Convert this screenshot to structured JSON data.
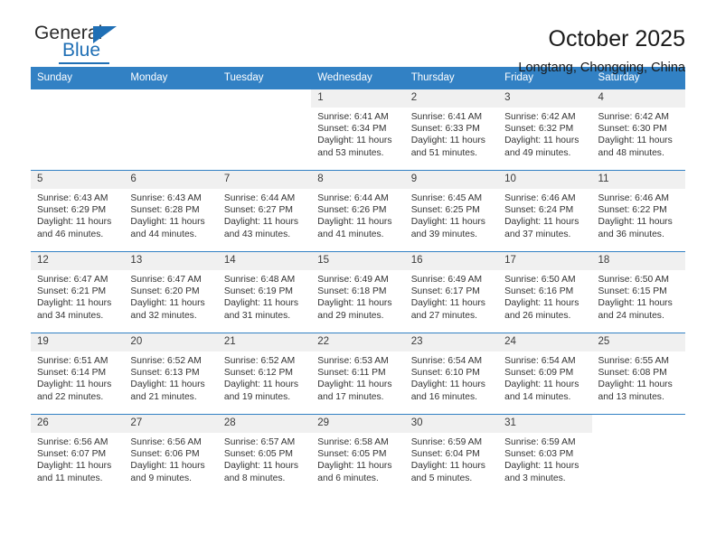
{
  "brand": {
    "name_part1": "General",
    "name_part2": "Blue",
    "accent_color": "#1f6fb5"
  },
  "header": {
    "title": "October 2025",
    "subtitle": "Longtang, Chongqing, China"
  },
  "calendar": {
    "header_bg": "#3281c4",
    "datenum_bg": "#f0f0f0",
    "weekdays": [
      "Sunday",
      "Monday",
      "Tuesday",
      "Wednesday",
      "Thursday",
      "Friday",
      "Saturday"
    ],
    "weeks": [
      [
        {
          "day": "",
          "sunrise": "",
          "sunset": "",
          "daylight1": "",
          "daylight2": ""
        },
        {
          "day": "",
          "sunrise": "",
          "sunset": "",
          "daylight1": "",
          "daylight2": ""
        },
        {
          "day": "",
          "sunrise": "",
          "sunset": "",
          "daylight1": "",
          "daylight2": ""
        },
        {
          "day": "1",
          "sunrise": "Sunrise: 6:41 AM",
          "sunset": "Sunset: 6:34 PM",
          "daylight1": "Daylight: 11 hours",
          "daylight2": "and 53 minutes."
        },
        {
          "day": "2",
          "sunrise": "Sunrise: 6:41 AM",
          "sunset": "Sunset: 6:33 PM",
          "daylight1": "Daylight: 11 hours",
          "daylight2": "and 51 minutes."
        },
        {
          "day": "3",
          "sunrise": "Sunrise: 6:42 AM",
          "sunset": "Sunset: 6:32 PM",
          "daylight1": "Daylight: 11 hours",
          "daylight2": "and 49 minutes."
        },
        {
          "day": "4",
          "sunrise": "Sunrise: 6:42 AM",
          "sunset": "Sunset: 6:30 PM",
          "daylight1": "Daylight: 11 hours",
          "daylight2": "and 48 minutes."
        }
      ],
      [
        {
          "day": "5",
          "sunrise": "Sunrise: 6:43 AM",
          "sunset": "Sunset: 6:29 PM",
          "daylight1": "Daylight: 11 hours",
          "daylight2": "and 46 minutes."
        },
        {
          "day": "6",
          "sunrise": "Sunrise: 6:43 AM",
          "sunset": "Sunset: 6:28 PM",
          "daylight1": "Daylight: 11 hours",
          "daylight2": "and 44 minutes."
        },
        {
          "day": "7",
          "sunrise": "Sunrise: 6:44 AM",
          "sunset": "Sunset: 6:27 PM",
          "daylight1": "Daylight: 11 hours",
          "daylight2": "and 43 minutes."
        },
        {
          "day": "8",
          "sunrise": "Sunrise: 6:44 AM",
          "sunset": "Sunset: 6:26 PM",
          "daylight1": "Daylight: 11 hours",
          "daylight2": "and 41 minutes."
        },
        {
          "day": "9",
          "sunrise": "Sunrise: 6:45 AM",
          "sunset": "Sunset: 6:25 PM",
          "daylight1": "Daylight: 11 hours",
          "daylight2": "and 39 minutes."
        },
        {
          "day": "10",
          "sunrise": "Sunrise: 6:46 AM",
          "sunset": "Sunset: 6:24 PM",
          "daylight1": "Daylight: 11 hours",
          "daylight2": "and 37 minutes."
        },
        {
          "day": "11",
          "sunrise": "Sunrise: 6:46 AM",
          "sunset": "Sunset: 6:22 PM",
          "daylight1": "Daylight: 11 hours",
          "daylight2": "and 36 minutes."
        }
      ],
      [
        {
          "day": "12",
          "sunrise": "Sunrise: 6:47 AM",
          "sunset": "Sunset: 6:21 PM",
          "daylight1": "Daylight: 11 hours",
          "daylight2": "and 34 minutes."
        },
        {
          "day": "13",
          "sunrise": "Sunrise: 6:47 AM",
          "sunset": "Sunset: 6:20 PM",
          "daylight1": "Daylight: 11 hours",
          "daylight2": "and 32 minutes."
        },
        {
          "day": "14",
          "sunrise": "Sunrise: 6:48 AM",
          "sunset": "Sunset: 6:19 PM",
          "daylight1": "Daylight: 11 hours",
          "daylight2": "and 31 minutes."
        },
        {
          "day": "15",
          "sunrise": "Sunrise: 6:49 AM",
          "sunset": "Sunset: 6:18 PM",
          "daylight1": "Daylight: 11 hours",
          "daylight2": "and 29 minutes."
        },
        {
          "day": "16",
          "sunrise": "Sunrise: 6:49 AM",
          "sunset": "Sunset: 6:17 PM",
          "daylight1": "Daylight: 11 hours",
          "daylight2": "and 27 minutes."
        },
        {
          "day": "17",
          "sunrise": "Sunrise: 6:50 AM",
          "sunset": "Sunset: 6:16 PM",
          "daylight1": "Daylight: 11 hours",
          "daylight2": "and 26 minutes."
        },
        {
          "day": "18",
          "sunrise": "Sunrise: 6:50 AM",
          "sunset": "Sunset: 6:15 PM",
          "daylight1": "Daylight: 11 hours",
          "daylight2": "and 24 minutes."
        }
      ],
      [
        {
          "day": "19",
          "sunrise": "Sunrise: 6:51 AM",
          "sunset": "Sunset: 6:14 PM",
          "daylight1": "Daylight: 11 hours",
          "daylight2": "and 22 minutes."
        },
        {
          "day": "20",
          "sunrise": "Sunrise: 6:52 AM",
          "sunset": "Sunset: 6:13 PM",
          "daylight1": "Daylight: 11 hours",
          "daylight2": "and 21 minutes."
        },
        {
          "day": "21",
          "sunrise": "Sunrise: 6:52 AM",
          "sunset": "Sunset: 6:12 PM",
          "daylight1": "Daylight: 11 hours",
          "daylight2": "and 19 minutes."
        },
        {
          "day": "22",
          "sunrise": "Sunrise: 6:53 AM",
          "sunset": "Sunset: 6:11 PM",
          "daylight1": "Daylight: 11 hours",
          "daylight2": "and 17 minutes."
        },
        {
          "day": "23",
          "sunrise": "Sunrise: 6:54 AM",
          "sunset": "Sunset: 6:10 PM",
          "daylight1": "Daylight: 11 hours",
          "daylight2": "and 16 minutes."
        },
        {
          "day": "24",
          "sunrise": "Sunrise: 6:54 AM",
          "sunset": "Sunset: 6:09 PM",
          "daylight1": "Daylight: 11 hours",
          "daylight2": "and 14 minutes."
        },
        {
          "day": "25",
          "sunrise": "Sunrise: 6:55 AM",
          "sunset": "Sunset: 6:08 PM",
          "daylight1": "Daylight: 11 hours",
          "daylight2": "and 13 minutes."
        }
      ],
      [
        {
          "day": "26",
          "sunrise": "Sunrise: 6:56 AM",
          "sunset": "Sunset: 6:07 PM",
          "daylight1": "Daylight: 11 hours",
          "daylight2": "and 11 minutes."
        },
        {
          "day": "27",
          "sunrise": "Sunrise: 6:56 AM",
          "sunset": "Sunset: 6:06 PM",
          "daylight1": "Daylight: 11 hours",
          "daylight2": "and 9 minutes."
        },
        {
          "day": "28",
          "sunrise": "Sunrise: 6:57 AM",
          "sunset": "Sunset: 6:05 PM",
          "daylight1": "Daylight: 11 hours",
          "daylight2": "and 8 minutes."
        },
        {
          "day": "29",
          "sunrise": "Sunrise: 6:58 AM",
          "sunset": "Sunset: 6:05 PM",
          "daylight1": "Daylight: 11 hours",
          "daylight2": "and 6 minutes."
        },
        {
          "day": "30",
          "sunrise": "Sunrise: 6:59 AM",
          "sunset": "Sunset: 6:04 PM",
          "daylight1": "Daylight: 11 hours",
          "daylight2": "and 5 minutes."
        },
        {
          "day": "31",
          "sunrise": "Sunrise: 6:59 AM",
          "sunset": "Sunset: 6:03 PM",
          "daylight1": "Daylight: 11 hours",
          "daylight2": "and 3 minutes."
        },
        {
          "day": "",
          "sunrise": "",
          "sunset": "",
          "daylight1": "",
          "daylight2": ""
        }
      ]
    ]
  }
}
